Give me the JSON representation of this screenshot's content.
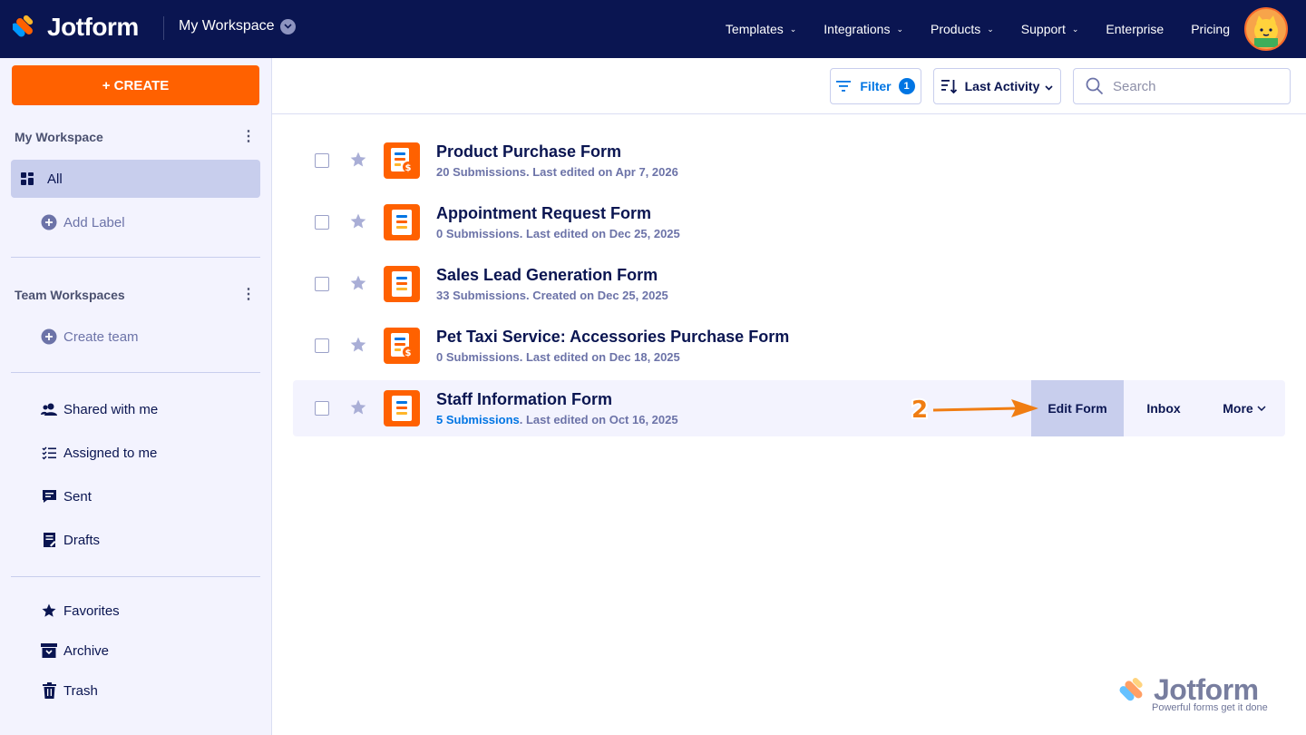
{
  "app": {
    "brand": "Jotform",
    "workspace_switch": "My Workspace"
  },
  "nav": {
    "items": [
      {
        "label": "Templates",
        "dropdown": true
      },
      {
        "label": "Integrations",
        "dropdown": true
      },
      {
        "label": "Products",
        "dropdown": true
      },
      {
        "label": "Support",
        "dropdown": true
      },
      {
        "label": "Enterprise",
        "dropdown": false
      },
      {
        "label": "Pricing",
        "dropdown": false
      }
    ]
  },
  "sidebar": {
    "create_label": "+ CREATE",
    "my_workspace_title": "My Workspace",
    "all_label": "All",
    "add_label": "Add Label",
    "team_workspaces_title": "Team Workspaces",
    "create_team": "Create team",
    "items": {
      "shared": "Shared with me",
      "assigned": "Assigned to me",
      "sent": "Sent",
      "drafts": "Drafts",
      "favorites": "Favorites",
      "archive": "Archive",
      "trash": "Trash"
    }
  },
  "toolbar": {
    "filter_label": "Filter",
    "filter_count": "1",
    "sort_label": "Last Activity",
    "search_placeholder": "Search"
  },
  "forms": [
    {
      "title": "Product Purchase Form",
      "submissions": "20 Submissions",
      "meta": ". Last edited on Apr 7, 2026",
      "icon": "payment-form-icon"
    },
    {
      "title": "Appointment Request Form",
      "submissions": "0 Submissions",
      "meta": ". Last edited on Dec 25, 2025",
      "icon": "form-icon"
    },
    {
      "title": "Sales Lead Generation Form",
      "submissions": "33 Submissions",
      "meta": ". Created on Dec 25, 2025",
      "icon": "form-icon"
    },
    {
      "title": "Pet Taxi Service: Accessories Purchase Form",
      "submissions": "0 Submissions",
      "meta": ". Last edited on Dec 18, 2025",
      "icon": "payment-form-icon"
    },
    {
      "title": "Staff Information Form",
      "submissions": "5 Submissions",
      "meta": ". Last edited on Oct 16, 2025",
      "icon": "form-icon"
    }
  ],
  "row_actions": {
    "edit": "Edit Form",
    "inbox": "Inbox",
    "more": "More"
  },
  "annotation": {
    "step": "2",
    "color": "#f07d12"
  },
  "watermark": {
    "brand": "Jotform",
    "tagline": "Powerful forms get it done"
  },
  "colors": {
    "nav_bg": "#0a1551",
    "accent_orange": "#ff6100",
    "link_blue": "#0075e3",
    "active_bg": "#c8ceed"
  }
}
